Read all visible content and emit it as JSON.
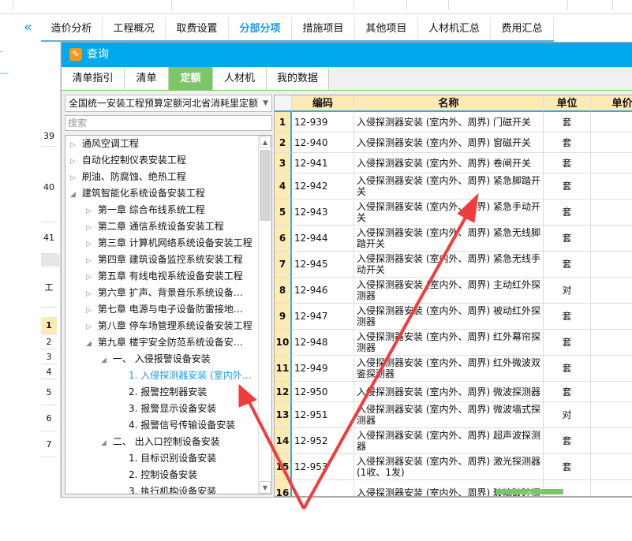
{
  "top_tabs": [
    "造价分析",
    "工程概况",
    "取费设置",
    "分部分项",
    "措施项目",
    "其他项目",
    "人材机汇总",
    "费用汇总"
  ],
  "active_top_tab": "分部分项",
  "bg_rows": [
    "39",
    "40",
    "41",
    "工",
    "1",
    "2",
    "3",
    "4",
    "5",
    "6",
    "7"
  ],
  "dialog": {
    "title": "查询",
    "tabs": [
      "清单指引",
      "清单",
      "定额",
      "人材机",
      "我的数据"
    ],
    "active_tab": "定额",
    "library": "全国统一安装工程预算定额河北省消耗里定额",
    "search_placeholder": "搜索",
    "tree": [
      {
        "label": "通风空调工程",
        "level": 0,
        "expanded": false
      },
      {
        "label": "自动化控制仪表安装工程",
        "level": 0,
        "expanded": false
      },
      {
        "label": "刷油、防腐蚀、绝热工程",
        "level": 0,
        "expanded": false
      },
      {
        "label": "建筑智能化系统设备安装工程",
        "level": 0,
        "expanded": true
      },
      {
        "label": "第一章  综合布线系统工程",
        "level": 1,
        "expanded": false
      },
      {
        "label": "第二章  通信系统设备安装工程",
        "level": 1,
        "expanded": false
      },
      {
        "label": "第三章  计算机网络系统设备安装工程",
        "level": 1,
        "expanded": false
      },
      {
        "label": "第四章  建筑设备监控系统安装工程",
        "level": 1,
        "expanded": false
      },
      {
        "label": "第五章  有线电视系统设备安装工程",
        "level": 1,
        "expanded": false
      },
      {
        "label": "第六章  扩声、背景音乐系统设备…",
        "level": 1,
        "expanded": false
      },
      {
        "label": "第七章  电源与电子设备防雷接地…",
        "level": 1,
        "expanded": false
      },
      {
        "label": "第八章  停车场管理系统设备安装工程",
        "level": 1,
        "expanded": false
      },
      {
        "label": "第九章  楼宇安全防范系统设备安…",
        "level": 1,
        "expanded": true
      },
      {
        "label": "一、  入侵报警设备安装",
        "level": 2,
        "expanded": true
      },
      {
        "label": "1.  入侵探测器安装 (室内外…",
        "level": 3,
        "selected": true
      },
      {
        "label": "2.  报警控制器安装",
        "level": 3
      },
      {
        "label": "3.  报警显示设备安装",
        "level": 3
      },
      {
        "label": "4.  报警信号传输设备安装",
        "level": 3
      },
      {
        "label": "二、  出入口控制设备安装",
        "level": 2,
        "expanded": true
      },
      {
        "label": "1.  目标识别设备安装",
        "level": 3
      },
      {
        "label": "2.  控制设备安装",
        "level": 3
      },
      {
        "label": "3.  执行机构设备安装",
        "level": 3
      }
    ],
    "table": {
      "columns": [
        "编码",
        "名称",
        "单位",
        "单价"
      ],
      "rows": [
        {
          "n": "1",
          "code": "12-939",
          "name": "入侵探测器安装 (室内外、周界) 门磁开关",
          "unit": "套"
        },
        {
          "n": "2",
          "code": "12-940",
          "name": "入侵探测器安装 (室内外、周界) 窗磁开关",
          "unit": "套"
        },
        {
          "n": "3",
          "code": "12-941",
          "name": "入侵探测器安装 (室内外、周界) 卷闸开关",
          "unit": "套"
        },
        {
          "n": "4",
          "code": "12-942",
          "name": "入侵探测器安装 (室内外、周界) 紧急脚踏开关",
          "unit": "套"
        },
        {
          "n": "5",
          "code": "12-943",
          "name": "入侵探测器安装 (室内外、周界) 紧急手动开关",
          "unit": "套"
        },
        {
          "n": "6",
          "code": "12-944",
          "name": "入侵探测器安装 (室内外、周界) 紧急无线脚踏开关",
          "unit": "套"
        },
        {
          "n": "7",
          "code": "12-945",
          "name": "入侵探测器安装 (室内外、周界) 紧急无线手动开关",
          "unit": "套"
        },
        {
          "n": "8",
          "code": "12-946",
          "name": "入侵探测器安装 (室内外、周界) 主动红外探测器",
          "unit": "对"
        },
        {
          "n": "9",
          "code": "12-947",
          "name": "入侵探测器安装 (室内外、周界) 被动红外探测器",
          "unit": "套"
        },
        {
          "n": "10",
          "code": "12-948",
          "name": "入侵探测器安装 (室内外、周界) 红外幕帘探测器",
          "unit": "套"
        },
        {
          "n": "11",
          "code": "12-949",
          "name": "入侵探测器安装 (室内外、周界) 红外微波双鉴探测器",
          "unit": "套"
        },
        {
          "n": "12",
          "code": "12-950",
          "name": "入侵探测器安装 (室内外、周界) 微波探测器",
          "unit": "套"
        },
        {
          "n": "13",
          "code": "12-951",
          "name": "入侵探测器安装 (室内外、周界) 微波墙式探测器",
          "unit": "对"
        },
        {
          "n": "14",
          "code": "12-952",
          "name": "入侵探测器安装 (室内外、周界) 超声波探测器",
          "unit": "套"
        },
        {
          "n": "15",
          "code": "12-953",
          "name": "入侵探测器安装 (室内外、周界) 激光探测器 (1收、1发)",
          "unit": "套"
        },
        {
          "n": "16",
          "code": "",
          "name": "入侵探测器安装 (室内外、周界) 玻璃破碎探",
          "unit": ""
        }
      ]
    }
  },
  "colors": {
    "accent": "#00a8ec",
    "green": "#7dc56a",
    "header": "#fdeab4",
    "arrow": "#f03c3c"
  }
}
